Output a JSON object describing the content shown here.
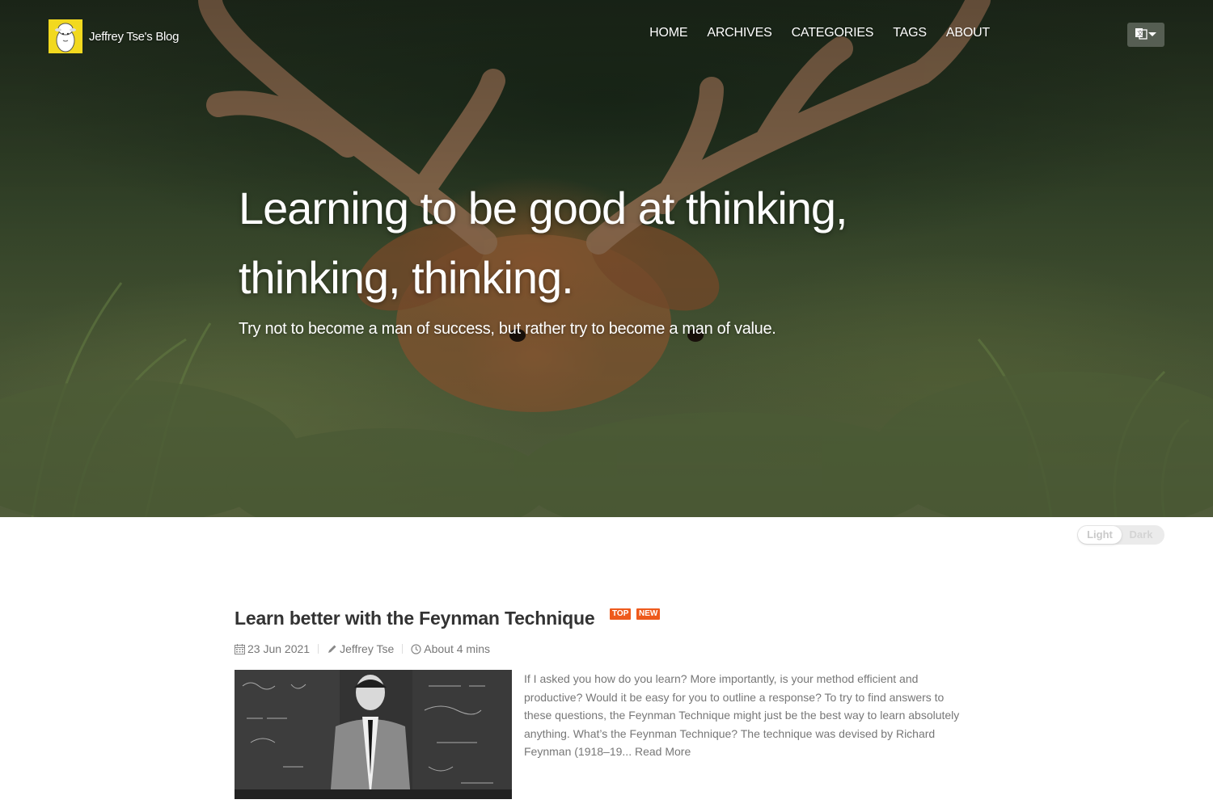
{
  "site": {
    "brand": "Jeffrey Tse's Blog",
    "logo_icon": "sheep-logo-icon"
  },
  "nav": {
    "items": [
      {
        "label": "HOME"
      },
      {
        "label": "ARCHIVES"
      },
      {
        "label": "CATEGORIES"
      },
      {
        "label": "TAGS"
      },
      {
        "label": "ABOUT"
      }
    ],
    "language_icon": "translate-icon"
  },
  "hero": {
    "title": "Learning to be good at thinking, thinking, thinking.",
    "subtitle": "Try not to become a man of success, but rather try to become a man of value."
  },
  "theme_toggle": {
    "light": "Light",
    "dark": "Dark",
    "selected": "Light"
  },
  "post": {
    "title": "Learn better with the Feynman Technique",
    "badges": [
      "TOP",
      "NEW"
    ],
    "date": "23 Jun 2021",
    "author": "Jeffrey Tse",
    "read_time": "About 4 mins",
    "excerpt": "If I asked you how do you learn? More importantly, is your method efficient and productive? Would it be easy for you to outline a response? To try to find answers to these questions, the Feynman Technique might just be the best way to learn absolutely anything. What’s the Feynman Technique? The technique was devised by Richard Feynman (1918–19...",
    "read_more": "Read More"
  },
  "colors": {
    "badge": "#ee5a1c",
    "logo_bg": "#f2d91f",
    "text_muted": "#777777",
    "title": "#333333"
  }
}
